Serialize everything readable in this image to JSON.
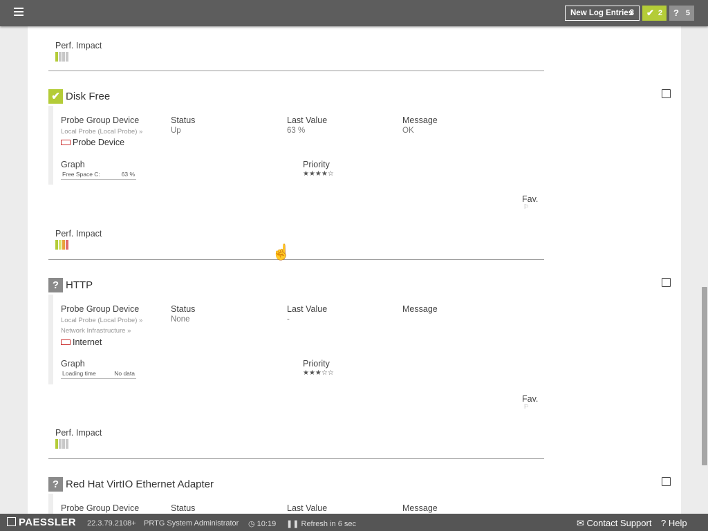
{
  "header": {
    "new_log_label": "New Log Entries",
    "new_log_count": "3",
    "badge_up_count": "2",
    "badge_unknown_count": "5"
  },
  "labels": {
    "perf_impact": "Perf. Impact",
    "probe_group_device": "Probe Group Device",
    "status": "Status",
    "last_value": "Last Value",
    "message": "Message",
    "graph": "Graph",
    "priority": "Priority",
    "fav": "Fav."
  },
  "sensors": [
    {
      "name": "Disk Free",
      "status_icon": "check-icon",
      "probe": "Local Probe (Local Probe) »",
      "group": "",
      "device": "Probe Device",
      "status": "Up",
      "last_value": "63 %",
      "message": "OK",
      "graph_label": "Free Space C:",
      "graph_value": "63 %",
      "priority_stars": "★★★★☆",
      "perf_colors": [
        "#b4cc38",
        "#d8e36a",
        "#e8a33d",
        "#e06b6b"
      ]
    },
    {
      "name": "HTTP",
      "status_icon": "question-icon",
      "probe": "Local Probe (Local Probe) »",
      "group": "Network Infrastructure »",
      "device": "Internet",
      "status": "None",
      "last_value": "-",
      "message": "",
      "graph_label": "Loading time",
      "graph_value": "No data",
      "priority_stars": "★★★☆☆",
      "perf_colors": [
        "#b4cc38",
        "#c8c8c8",
        "#c8c8c8",
        "#c8c8c8"
      ]
    },
    {
      "name": "Red Hat VirtIO Ethernet Adapter",
      "status_icon": "question-icon"
    }
  ],
  "top_perf_colors": [
    "#b4cc38",
    "#c8c8c8",
    "#c8c8c8",
    "#c8c8c8"
  ],
  "footer": {
    "brand": "PAESSLER",
    "version": "22.3.79.2108+",
    "user": "PRTG System Administrator",
    "time": "10:19",
    "refresh": "Refresh in 6 sec",
    "contact": "Contact Support",
    "help": "Help"
  }
}
